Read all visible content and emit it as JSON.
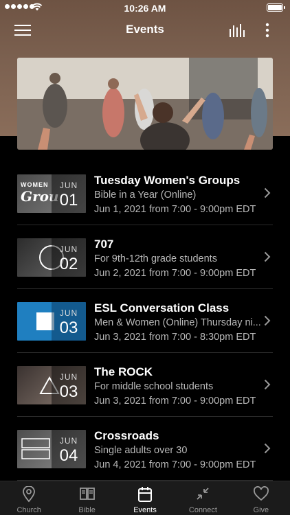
{
  "status_bar": {
    "time": "10:26 AM"
  },
  "navbar": {
    "title": "Events"
  },
  "events": [
    {
      "title": "Tuesday Women's Groups",
      "subtitle": "Bible in a Year (Online)",
      "date": "Jun 1, 2021 from 7:00 - 9:00pm EDT",
      "month": "JUN",
      "day": "01"
    },
    {
      "title": "707",
      "subtitle": "For 9th-12th grade students",
      "date": "Jun 2, 2021 from 7:00 - 9:00pm EDT",
      "month": "JUN",
      "day": "02"
    },
    {
      "title": "ESL Conversation Class",
      "subtitle": "Men & Women (Online) Thursday ni...",
      "date": "Jun 3, 2021 from 7:00 - 8:30pm EDT",
      "month": "JUN",
      "day": "03"
    },
    {
      "title": "The ROCK",
      "subtitle": "For middle school students",
      "date": "Jun 3, 2021 from 7:00 - 9:00pm EDT",
      "month": "JUN",
      "day": "03"
    },
    {
      "title": "Crossroads",
      "subtitle": "Single adults over 30",
      "date": "Jun 4, 2021 from 7:00 - 9:00pm EDT",
      "month": "JUN",
      "day": "04"
    }
  ],
  "tabs": [
    {
      "label": "Church",
      "icon": "map-pin-icon"
    },
    {
      "label": "Bible",
      "icon": "book-icon"
    },
    {
      "label": "Events",
      "icon": "calendar-icon",
      "active": true
    },
    {
      "label": "Connect",
      "icon": "arrows-in-icon"
    },
    {
      "label": "Give",
      "icon": "heart-icon"
    }
  ],
  "colors": {
    "header": "#7c6150",
    "background": "#000000",
    "tabbar": "#1b1b1b",
    "secondary_text": "#b9b9b9",
    "esl_blue": "#1f7fc0"
  }
}
